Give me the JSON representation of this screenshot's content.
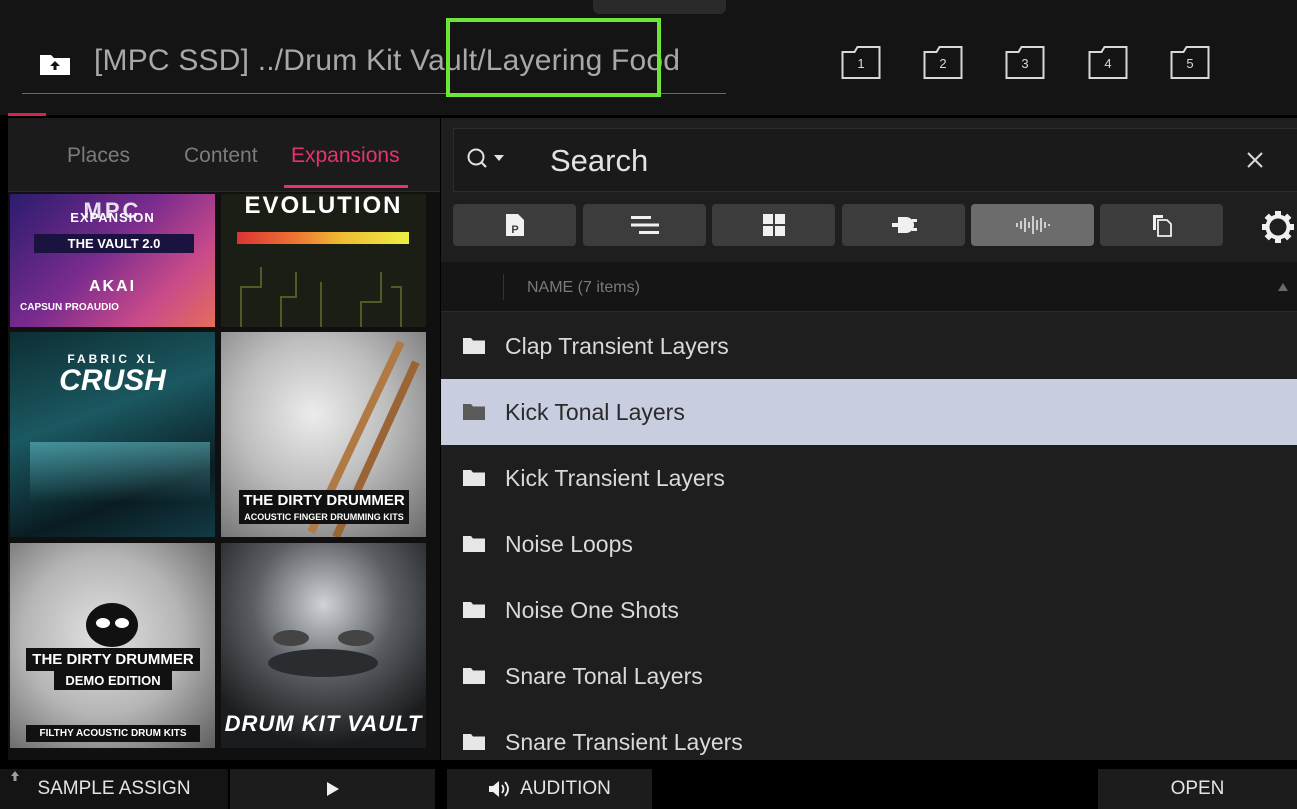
{
  "header": {
    "path": "[MPC SSD] ../Drum Kit Vault/Layering Food",
    "slots": [
      "1",
      "2",
      "3",
      "4",
      "5"
    ]
  },
  "left_panel": {
    "tabs": [
      {
        "label": "Places",
        "active": false
      },
      {
        "label": "Content",
        "active": false
      },
      {
        "label": "Expansions",
        "active": true
      }
    ],
    "tiles": [
      {
        "lines": [
          "MPC",
          "EXPANSION",
          "THE VAULT 2.0",
          "AKAI",
          "CAPSUN PROAUDIO"
        ]
      },
      {
        "lines": [
          "EVOLUTION"
        ]
      },
      {
        "lines": [
          "FABRIC XL",
          "CRUSH"
        ]
      },
      {
        "lines": [
          "THE DIRTY DRUMMER",
          "ACOUSTIC FINGER DRUMMING KITS"
        ]
      },
      {
        "lines": [
          "THE DIRTY DRUMMER",
          "DEMO EDITION",
          "FILTHY ACOUSTIC DRUM KITS"
        ]
      },
      {
        "lines": [
          "DRUM KIT VAULT"
        ]
      }
    ]
  },
  "search": {
    "placeholder": "Search"
  },
  "filters": [
    {
      "icon": "program-icon",
      "active": false
    },
    {
      "icon": "sequence-icon",
      "active": false
    },
    {
      "icon": "grid-icon",
      "active": false
    },
    {
      "icon": "plugin-icon",
      "active": false
    },
    {
      "icon": "waveform-icon",
      "active": true
    },
    {
      "icon": "copy-icon",
      "active": false
    }
  ],
  "list": {
    "header": "NAME (7 items)",
    "items": [
      {
        "name": "Clap Transient Layers",
        "selected": false
      },
      {
        "name": "Kick Tonal Layers",
        "selected": true
      },
      {
        "name": "Kick Transient Layers",
        "selected": false
      },
      {
        "name": "Noise Loops",
        "selected": false
      },
      {
        "name": "Noise One Shots",
        "selected": false
      },
      {
        "name": "Snare Tonal Layers",
        "selected": false
      },
      {
        "name": "Snare Transient Layers",
        "selected": false
      }
    ]
  },
  "footer": {
    "sample_assign": "SAMPLE ASSIGN",
    "play_icon": "play-icon",
    "audition": "AUDITION",
    "open": "OPEN"
  },
  "colors": {
    "accent": "#e6336b",
    "highlight": "#6de43a",
    "selection": "#c9cde0"
  }
}
